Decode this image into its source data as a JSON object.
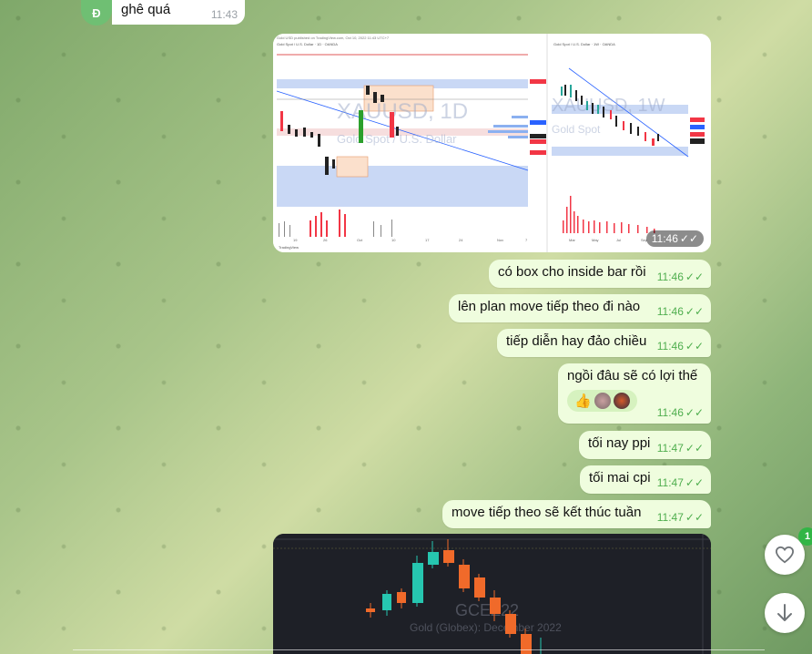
{
  "incoming": {
    "avatar_letter": "Đ",
    "text": "ghê quá",
    "time": "11:43"
  },
  "photo1": {
    "time": "11:46",
    "left_chart": {
      "symbol": "XAUUSD, 1D",
      "subtitle": "Gold Spot / U.S. Dollar",
      "footer": "TradingView",
      "header": "Gold Spot / U.S. Dollar · 1D · OANDA",
      "published": "Gold USD published on TradingView.com, Oct 10, 2022 11:43 UTC+7",
      "x_labels": [
        "19",
        "26",
        "Oct",
        "10",
        "17",
        "24",
        "Nov",
        "7"
      ]
    },
    "right_chart": {
      "symbol": "XAUUSD, 1W",
      "subtitle": "Gold Spot",
      "header": "Gold Spot / U.S. Dollar · 1W · OANDA",
      "x_labels": [
        "Mar",
        "May",
        "Jul",
        "Sep"
      ]
    }
  },
  "messages": [
    {
      "text": "có box cho inside bar rồi",
      "time": "11:46"
    },
    {
      "text": "lên plan move tiếp  theo đi nào",
      "time": "11:46"
    },
    {
      "text": "tiếp diễn hay đảo chiều",
      "time": "11:46"
    },
    {
      "text": "ngồi đâu sẽ có lợi thế",
      "time": "11:46",
      "reaction": "👍"
    },
    {
      "text": "tối nay ppi",
      "time": "11:47"
    },
    {
      "text": "tối mai cpi",
      "time": "11:47"
    },
    {
      "text": "move tiếp theo sẽ kết thúc tuần",
      "time": "11:47"
    }
  ],
  "photo2": {
    "symbol": "GCEZ22",
    "subtitle": "Gold (Globex): December 2022"
  },
  "fab": {
    "badge": "1"
  },
  "colors": {
    "out_bubble": "#effdde",
    "check_green": "#4fae4e",
    "bull_candle": "#26a69a",
    "bear_candle": "#f06a2a"
  }
}
